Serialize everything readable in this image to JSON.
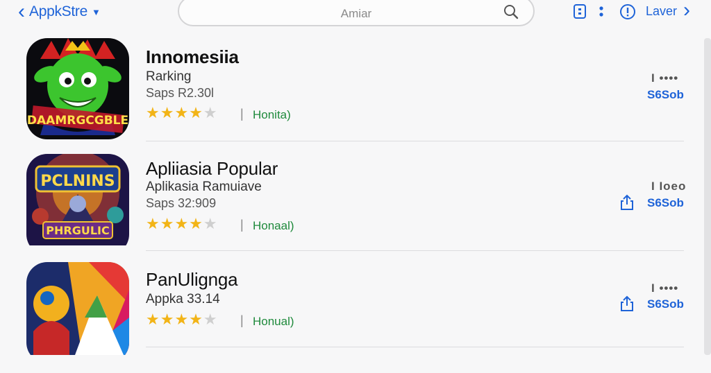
{
  "header": {
    "back_title": "AppkStre",
    "search_placeholder": "Amiar",
    "later_label": "Laver"
  },
  "apps": [
    {
      "name": "Innomesiia",
      "subtitle": "Rarking",
      "meta": "Saps R2.30l",
      "rating": 4.5,
      "category": "Honita)",
      "menu": "I ••••",
      "action": "S6Sob"
    },
    {
      "name": "Apliiasia Popular",
      "subtitle": "Aplikasia Ramuiave",
      "meta": "Saps 32:909",
      "rating": 4.5,
      "category": "Honaal)",
      "menu": "I Ioeo",
      "action": "S6Sob"
    },
    {
      "name": "PanUlignga",
      "subtitle": "Appka 33.14",
      "meta": "",
      "rating": 4.5,
      "category": "Honual)",
      "menu": "I ••••",
      "action": "S6Sob"
    }
  ],
  "icon_art": {
    "app1_banner": "DAAMRGCGBLE",
    "app2_top": "PCLNINS",
    "app2_bottom": "PHRGULIC"
  },
  "colors": {
    "accent": "#1e63d8",
    "star": "#f2b417",
    "category": "#1f8a3c"
  }
}
